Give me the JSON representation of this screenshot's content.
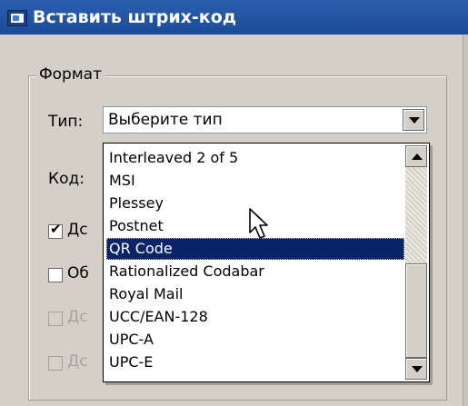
{
  "window": {
    "title": "Вставить штрих-код"
  },
  "group": {
    "title": "Формат"
  },
  "labels": {
    "type": "Тип:",
    "code": "Код:"
  },
  "combo": {
    "value": "Выберите тип"
  },
  "checkboxes": [
    {
      "text": "Дс",
      "checked": true,
      "enabled": true
    },
    {
      "text": "Об",
      "checked": false,
      "enabled": true
    },
    {
      "text": "Дс",
      "checked": false,
      "enabled": false
    },
    {
      "text": "Дс",
      "checked": false,
      "enabled": false
    }
  ],
  "dropdown": {
    "items": [
      "Interleaved 2 of 5",
      "MSI",
      "Plessey",
      "Postnet",
      "QR Code",
      "Rationalized Codabar",
      "Royal Mail",
      "UCC/EAN-128",
      "UPC-A",
      "UPC-E"
    ],
    "selected_index": 4
  },
  "colors": {
    "title_bar": "#1c4b98",
    "selection": "#0a246a"
  }
}
